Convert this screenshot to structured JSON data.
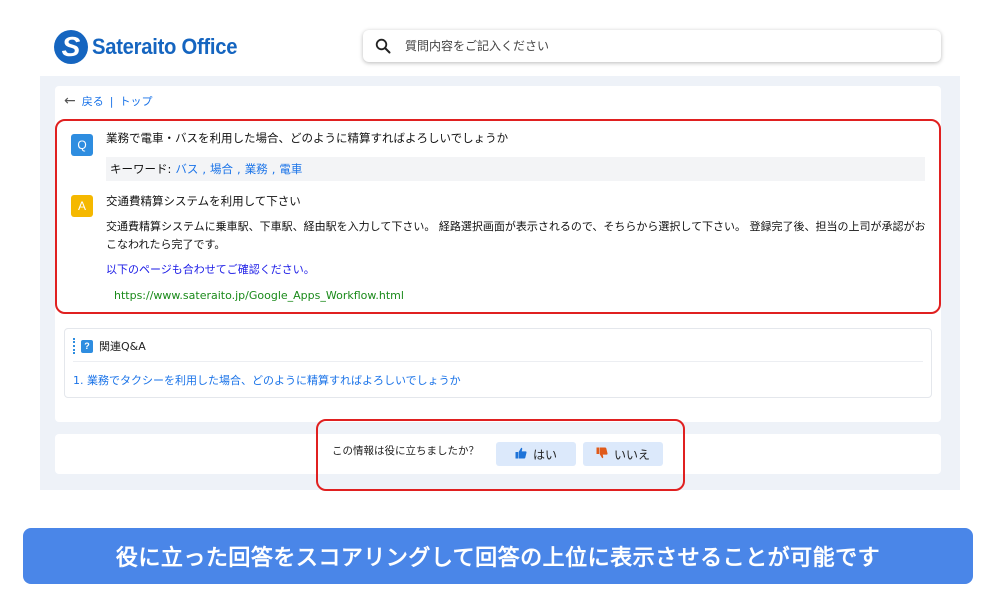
{
  "header": {
    "logo_text": "Sateraito Office",
    "logo_letter": "S",
    "search_placeholder": "質問内容をご記入ください"
  },
  "nav": {
    "back_label": "戻る",
    "separator": "|",
    "top_label": "トップ"
  },
  "question": {
    "badge": "Q",
    "text": "業務で電車・バスを利用した場合、どのように精算すればよろしいでしょうか",
    "keywords_label": "キーワード:",
    "keywords": [
      "バス",
      "場合",
      "業務",
      "電車"
    ]
  },
  "answer": {
    "badge": "A",
    "title": "交通費精算システムを利用して下さい",
    "body": "交通費精算システムに乗車駅、下車駅、経由駅を入力して下さい。 経路選択画面が表示されるので、そちらから選択して下さい。 登録完了後、担当の上司が承認がおこなわれたら完了です。",
    "link_intro": "以下のページも合わせてご確認ください。",
    "url": "https://www.sateraito.jp/Google_Apps_Workflow.html"
  },
  "related": {
    "title": "関連Q&A",
    "icon_char": "?",
    "items": [
      "1. 業務でタクシーを利用した場合、どのように精算すればよろしいでしょうか"
    ]
  },
  "feedback": {
    "question": "この情報は役に立ちましたか？",
    "yes_label": "はい",
    "no_label": "いいえ"
  },
  "banner": {
    "text": "役に立った回答をスコアリングして回答の上位に表示させることが可能です"
  },
  "colors": {
    "brand": "#1565c0",
    "highlight_border": "#e02020",
    "banner": "#4a86e8"
  }
}
